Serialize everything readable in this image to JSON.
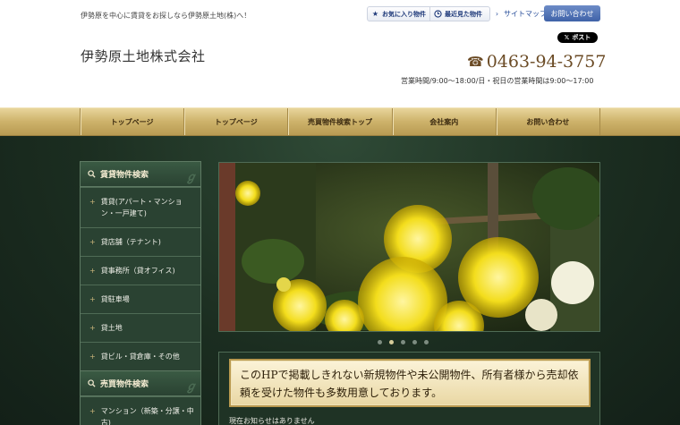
{
  "header": {
    "tagline": "伊勢原を中心に賃貸をお探しなら伊勢原土地(株)へ！",
    "favorites_label": "お気に入り物件",
    "recent_label": "最近見た物件",
    "sitemap_label": "サイトマップ",
    "contact_label": "お問い合わせ",
    "x_post_label": "ポスト",
    "company_name": "伊勢原土地株式会社",
    "phone": "0463-94-3757",
    "hours": "営業時間/9:00～18:00/日・祝日の営業時間は9:00～17:00"
  },
  "nav": {
    "items": [
      "トップページ",
      "トップページ",
      "売買物件検索トップ",
      "会社案内",
      "お問い合わせ"
    ]
  },
  "sidebar": {
    "rental": {
      "title": "賃貸物件検索",
      "items": [
        "賃貸(アパート・マンション・一戸建て)",
        "貸店舗（テナント)",
        "貸事務所（貸オフィス)",
        "貸駐車場",
        "貸土地",
        "貸ビル・貸倉庫・その他"
      ]
    },
    "sale": {
      "title": "売買物件検索",
      "items": [
        "マンション（新築・分譲・中古)"
      ]
    }
  },
  "slider": {
    "slide_count": 5,
    "active_index": 1
  },
  "banner": {
    "text": "このHPで掲載しきれない新規物件や未公開物件、所有者様から売却依頼を受けた物件も多数用意しております。"
  },
  "notice": {
    "text": "現在お知らせはありません"
  },
  "colors": {
    "nav_gold": "#cdb26a",
    "main_green": "#1b2d20",
    "contact_blue": "#3f62a8",
    "phone_brown": "#6b4b25"
  }
}
